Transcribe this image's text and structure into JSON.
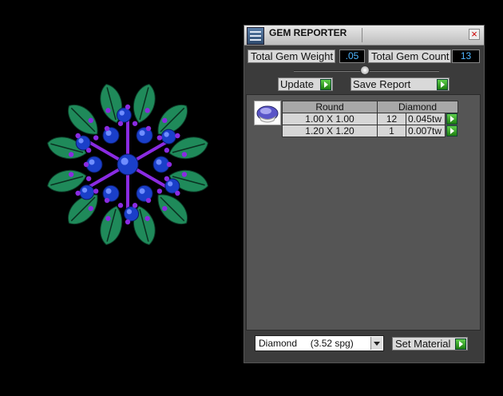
{
  "viewport": {
    "content": "jewel-render-3d"
  },
  "panel": {
    "title": "GEM REPORTER",
    "close_glyph": "×",
    "stats": {
      "weight_label": "Total Gem Weight",
      "weight_value": ".05",
      "count_label": "Total Gem Count",
      "count_value": "13"
    },
    "buttons": {
      "update": "Update",
      "save_report": "Save Report",
      "set_material": "Set Material"
    },
    "table": {
      "headers": [
        "Round",
        "Diamond"
      ],
      "rows": [
        {
          "size": "1.00 X 1.00",
          "count": "12",
          "weight": "0.045tw"
        },
        {
          "size": "1.20 X 1.20",
          "count": "1",
          "weight": "0.007tw"
        }
      ]
    },
    "material_select": {
      "value": "Diamond     (3.52 spg)"
    }
  },
  "colors": {
    "value_text": "#4fb6ff",
    "go_green": "#2fa81c",
    "petal_green": "#1f8a5a",
    "gem_blue": "#1a3fc9",
    "prong_purple": "#8a2be2"
  }
}
